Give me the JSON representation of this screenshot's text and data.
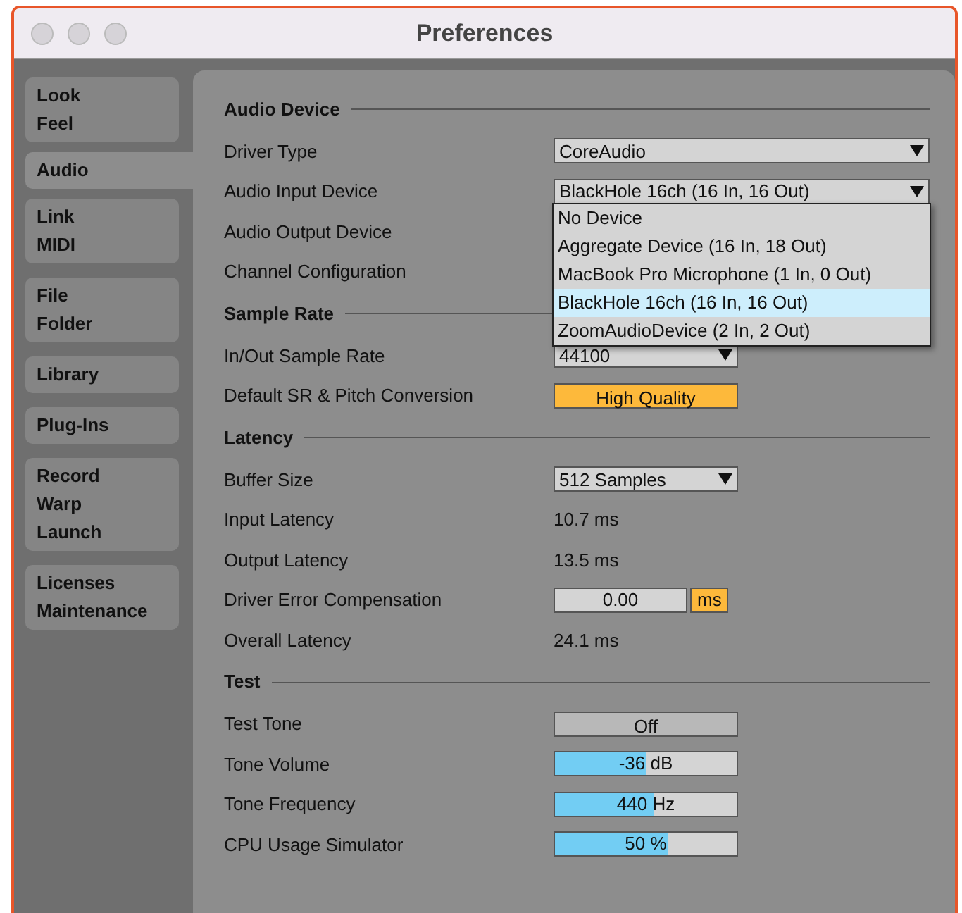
{
  "window": {
    "title": "Preferences"
  },
  "sidebar": {
    "groups": [
      {
        "selected": false,
        "items": [
          "Look",
          "Feel"
        ]
      },
      {
        "selected": true,
        "items": [
          "Audio"
        ]
      },
      {
        "selected": false,
        "items": [
          "Link",
          "MIDI"
        ]
      },
      {
        "selected": false,
        "items": [
          "File",
          "Folder"
        ]
      },
      {
        "selected": false,
        "items": [
          "Library"
        ]
      },
      {
        "selected": false,
        "items": [
          "Plug-Ins"
        ]
      },
      {
        "selected": false,
        "items": [
          "Record",
          "Warp",
          "Launch"
        ]
      },
      {
        "selected": false,
        "items": [
          "Licenses",
          "Maintenance"
        ]
      }
    ]
  },
  "sections": [
    {
      "title": "Audio Device",
      "rows": [
        {
          "label": "Driver Type",
          "kind": "wide-dropdown",
          "value": "CoreAudio"
        },
        {
          "label": "Audio Input Device",
          "kind": "wide-dropdown",
          "value": "BlackHole 16ch (16 In, 16 Out)",
          "menu": [
            {
              "label": "No Device",
              "selected": false
            },
            {
              "label": "Aggregate Device (16 In, 18 Out)",
              "selected": false
            },
            {
              "label": "MacBook Pro Microphone (1 In, 0 Out)",
              "selected": false
            },
            {
              "label": "BlackHole 16ch (16 In, 16 Out)",
              "selected": true
            },
            {
              "label": "ZoomAudioDevice (2 In, 2 Out)",
              "selected": false
            }
          ]
        },
        {
          "label": "Audio Output Device",
          "kind": "hidden"
        },
        {
          "label": "Channel Configuration",
          "kind": "hidden"
        }
      ]
    },
    {
      "title": "Sample Rate",
      "rows": [
        {
          "label": "In/Out Sample Rate",
          "kind": "dropdown",
          "value": "44100"
        },
        {
          "label": "Default SR & Pitch Conversion",
          "kind": "toggle",
          "value": "High Quality",
          "on": true
        }
      ]
    },
    {
      "title": "Latency",
      "rows": [
        {
          "label": "Buffer Size",
          "kind": "dropdown",
          "value": "512 Samples"
        },
        {
          "label": "Input Latency",
          "kind": "text",
          "value": "10.7 ms"
        },
        {
          "label": "Output Latency",
          "kind": "text",
          "value": "13.5 ms"
        },
        {
          "label": "Driver Error Compensation",
          "kind": "number",
          "value": "0.00",
          "unit": "ms"
        },
        {
          "label": "Overall Latency",
          "kind": "text",
          "value": "24.1 ms"
        }
      ]
    },
    {
      "title": "Test",
      "rows": [
        {
          "label": "Test Tone",
          "kind": "toggle",
          "value": "Off",
          "on": false
        },
        {
          "label": "Tone Volume",
          "kind": "slider",
          "value": "-36 dB",
          "level": 0.5
        },
        {
          "label": "Tone Frequency",
          "kind": "slider",
          "value": "440 Hz",
          "level": 0.54
        },
        {
          "label": "CPU Usage Simulator",
          "kind": "slider",
          "value": "50 %",
          "level": 0.62
        }
      ]
    }
  ]
}
